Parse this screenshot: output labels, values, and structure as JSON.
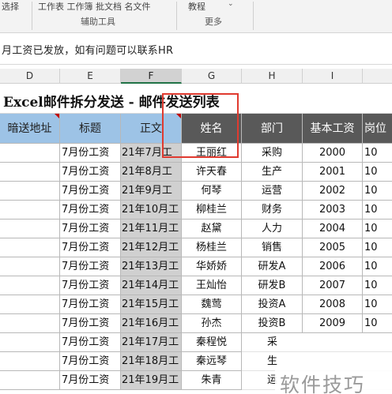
{
  "ribbon": {
    "top_left": "选择",
    "top_mid": "工作表 工作簿 批文档 名文件",
    "top_right": "教程",
    "group_left": "辅助工具",
    "group_right": "更多"
  },
  "notice": "月工资已发放，如有问题可以联系HR",
  "columns": [
    "D",
    "E",
    "F",
    "G",
    "H",
    "I"
  ],
  "selected_column": "F",
  "sheet_title": "Excel邮件拆分发送 - 邮件发送列表",
  "headers": {
    "bcc": "暗送地址",
    "subject": "标题",
    "body": "正文",
    "name": "姓名",
    "dept": "部门",
    "salary": "基本工资",
    "position": "岗位"
  },
  "rows": [
    {
      "subject": "7月份工资",
      "body": "21年7月工",
      "name": "王丽红",
      "dept": "采购",
      "salary": "2000",
      "position": "10"
    },
    {
      "subject": "7月份工资",
      "body": "21年8月工",
      "name": "许天春",
      "dept": "生产",
      "salary": "2001",
      "position": "10"
    },
    {
      "subject": "7月份工资",
      "body": "21年9月工",
      "name": "何琴",
      "dept": "运营",
      "salary": "2002",
      "position": "10"
    },
    {
      "subject": "7月份工资",
      "body": "21年10月工",
      "name": "柳桂兰",
      "dept": "财务",
      "salary": "2003",
      "position": "10"
    },
    {
      "subject": "7月份工资",
      "body": "21年11月工",
      "name": "赵黛",
      "dept": "人力",
      "salary": "2004",
      "position": "10"
    },
    {
      "subject": "7月份工资",
      "body": "21年12月工",
      "name": "杨桂兰",
      "dept": "销售",
      "salary": "2005",
      "position": "10"
    },
    {
      "subject": "7月份工资",
      "body": "21年13月工",
      "name": "华娇娇",
      "dept": "研发A",
      "salary": "2006",
      "position": "10"
    },
    {
      "subject": "7月份工资",
      "body": "21年14月工",
      "name": "王灿怡",
      "dept": "研发B",
      "salary": "2007",
      "position": "10"
    },
    {
      "subject": "7月份工资",
      "body": "21年15月工",
      "name": "魏莺",
      "dept": "投资A",
      "salary": "2008",
      "position": "10"
    },
    {
      "subject": "7月份工资",
      "body": "21年16月工",
      "name": "孙杰",
      "dept": "投资B",
      "salary": "2009",
      "position": "10"
    },
    {
      "subject": "7月份工资",
      "body": "21年17月工",
      "name": "秦程悦",
      "dept": "采",
      "salary": "",
      "position": ""
    },
    {
      "subject": "7月份工资",
      "body": "21年18月工",
      "name": "秦远琴",
      "dept": "生",
      "salary": "",
      "position": ""
    },
    {
      "subject": "7月份工资",
      "body": "21年19月工",
      "name": "朱青",
      "dept": "运",
      "salary": "",
      "position": ""
    }
  ],
  "watermark": "软件技巧",
  "colors": {
    "header_blue": "#9dc3e6",
    "header_dark": "#595959",
    "selected_column_fill": "#d0d0d0",
    "highlight_box": "#e03a2f"
  }
}
